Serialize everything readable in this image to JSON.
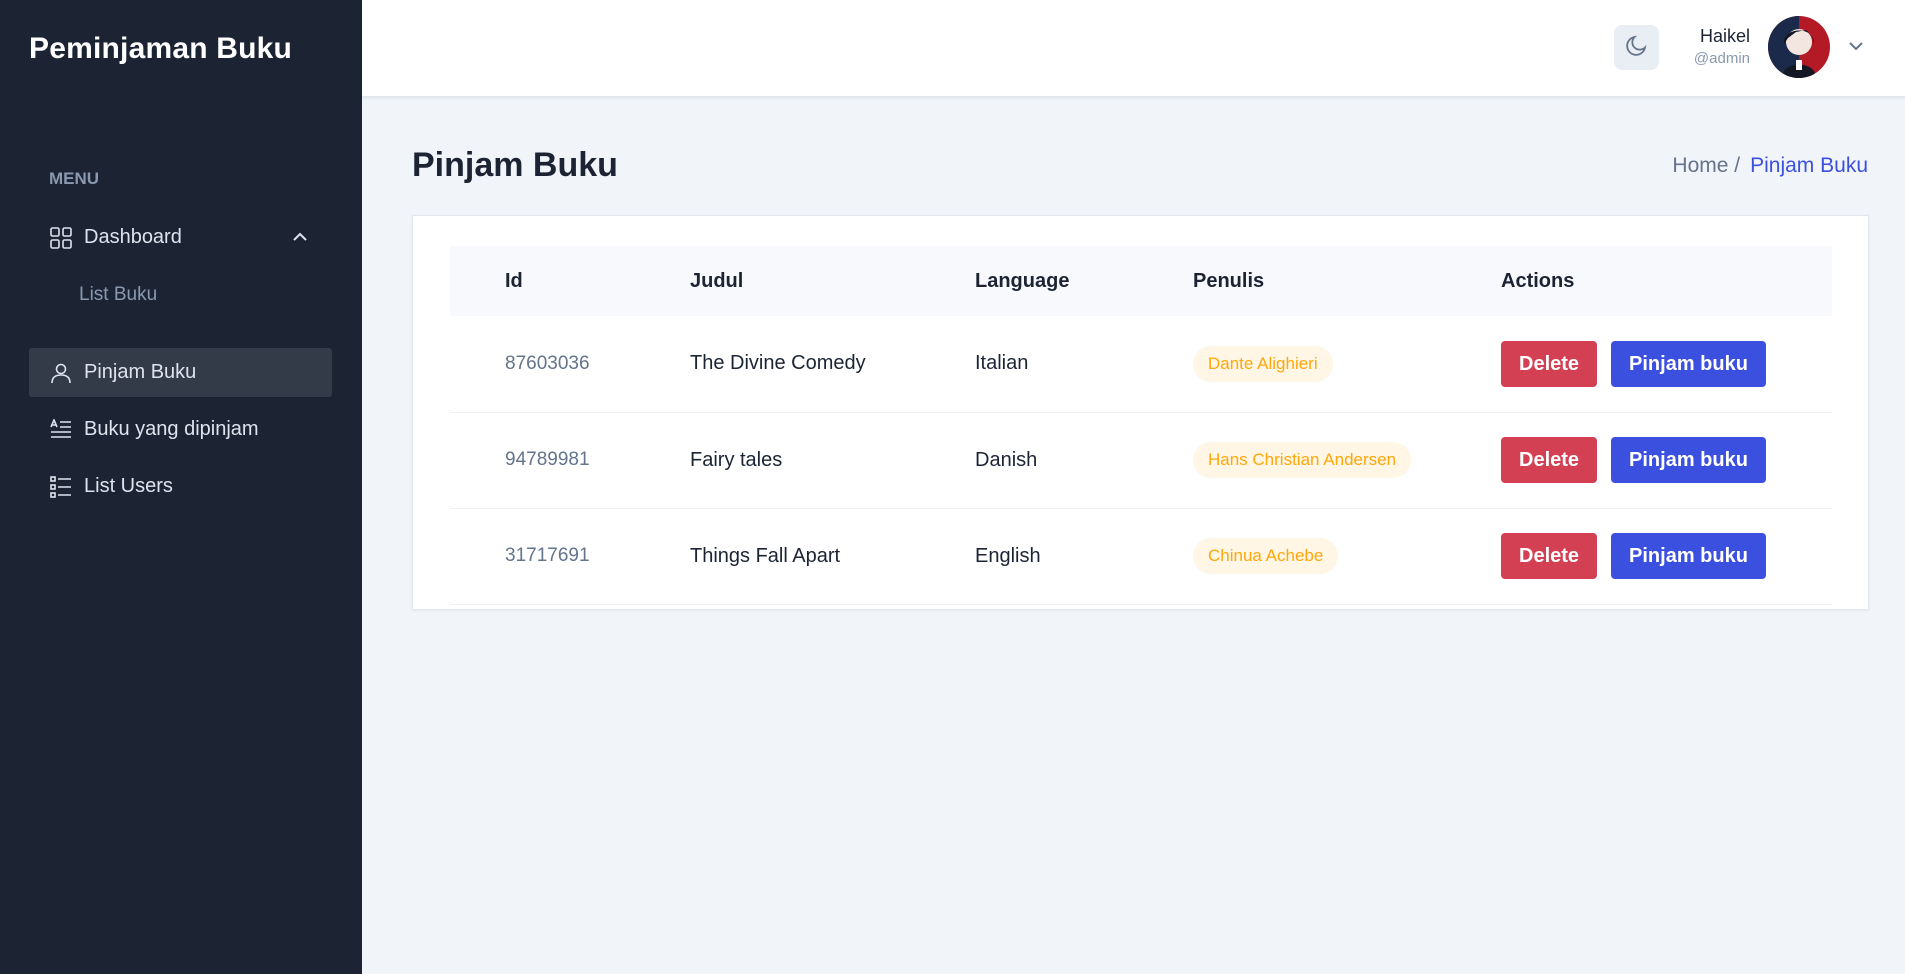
{
  "sidebar": {
    "brand": "Peminjaman Buku",
    "menu_label": "MENU",
    "items": [
      {
        "label": "Dashboard",
        "icon": "grid-icon"
      },
      {
        "label": "List Buku"
      },
      {
        "label": "Pinjam Buku",
        "icon": "user-icon"
      },
      {
        "label": "Buku yang dipinjam",
        "icon": "text-align-icon"
      },
      {
        "label": "List Users",
        "icon": "list-icon"
      }
    ]
  },
  "header": {
    "theme_icon": "moon-icon",
    "user_name": "Haikel",
    "user_role": "@admin"
  },
  "main": {
    "title": "Pinjam Buku",
    "breadcrumb": {
      "home": "Home /",
      "current": "Pinjam Buku"
    },
    "table": {
      "headers": [
        "Id",
        "Judul",
        "Language",
        "Penulis",
        "Actions"
      ],
      "rows": [
        {
          "id": "87603036",
          "judul": "The Divine Comedy",
          "language": "Italian",
          "penulis": "Dante Alighieri"
        },
        {
          "id": "94789981",
          "judul": "Fairy tales",
          "language": "Danish",
          "penulis": "Hans Christian Andersen"
        },
        {
          "id": "31717691",
          "judul": "Things Fall Apart",
          "language": "English",
          "penulis": "Chinua Achebe"
        }
      ],
      "delete_label": "Delete",
      "pinjam_label": "Pinjam buku"
    }
  },
  "colors": {
    "sidebar_bg": "#1c2434",
    "primary": "#3c50e0",
    "danger": "#d34053",
    "warning": "#ffa70b"
  }
}
